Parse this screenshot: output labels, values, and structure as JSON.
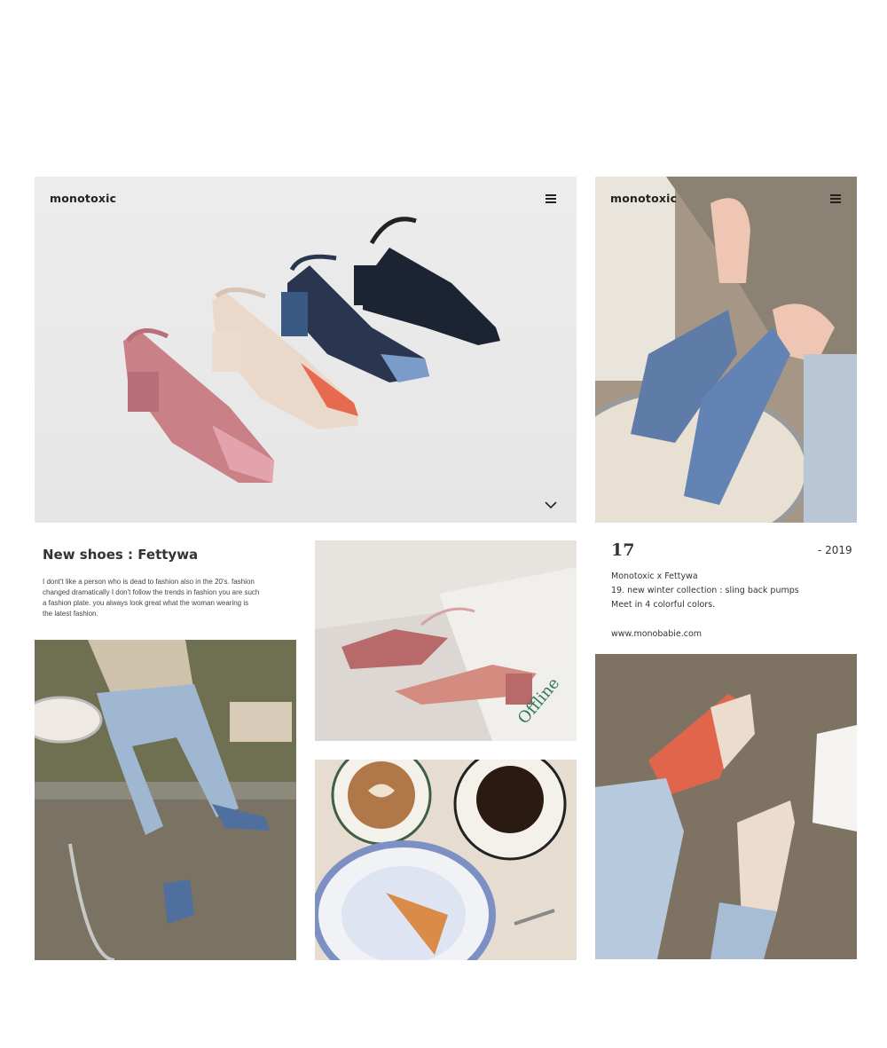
{
  "hero": {
    "brand": "monotoxic",
    "menu_icon": "hamburger-menu-icon",
    "scroll_icon": "chevron-down-icon"
  },
  "side_hero": {
    "brand": "monotoxic",
    "menu_icon": "hamburger-menu-icon"
  },
  "intro": {
    "title": "New shoes : Fettywa",
    "lines": [
      "I dont't like a person who is dead to fashion also in the 20's. fashion",
      "changed dramatically I don't follow the trends in fashion you are such",
      "a fashion plate. you always look great what the woman wearing is",
      "the latest fashion."
    ]
  },
  "collection": {
    "day": "17",
    "year": "- 2019",
    "lines": [
      "Monotoxic x Fettywa",
      "19. new winter collection : sling back pumps",
      "Meet in 4 colorful colors."
    ],
    "website": "www.monobabie.com"
  },
  "photo_text": {
    "magazine_word": "Offline"
  },
  "colors": {
    "accent_coral": "#e86a4e",
    "shoe_blue": "#5a78a8",
    "shoe_navy": "#1f2a3d",
    "shoe_pink": "#c97a82",
    "shoe_cream": "#ecd9cb"
  }
}
